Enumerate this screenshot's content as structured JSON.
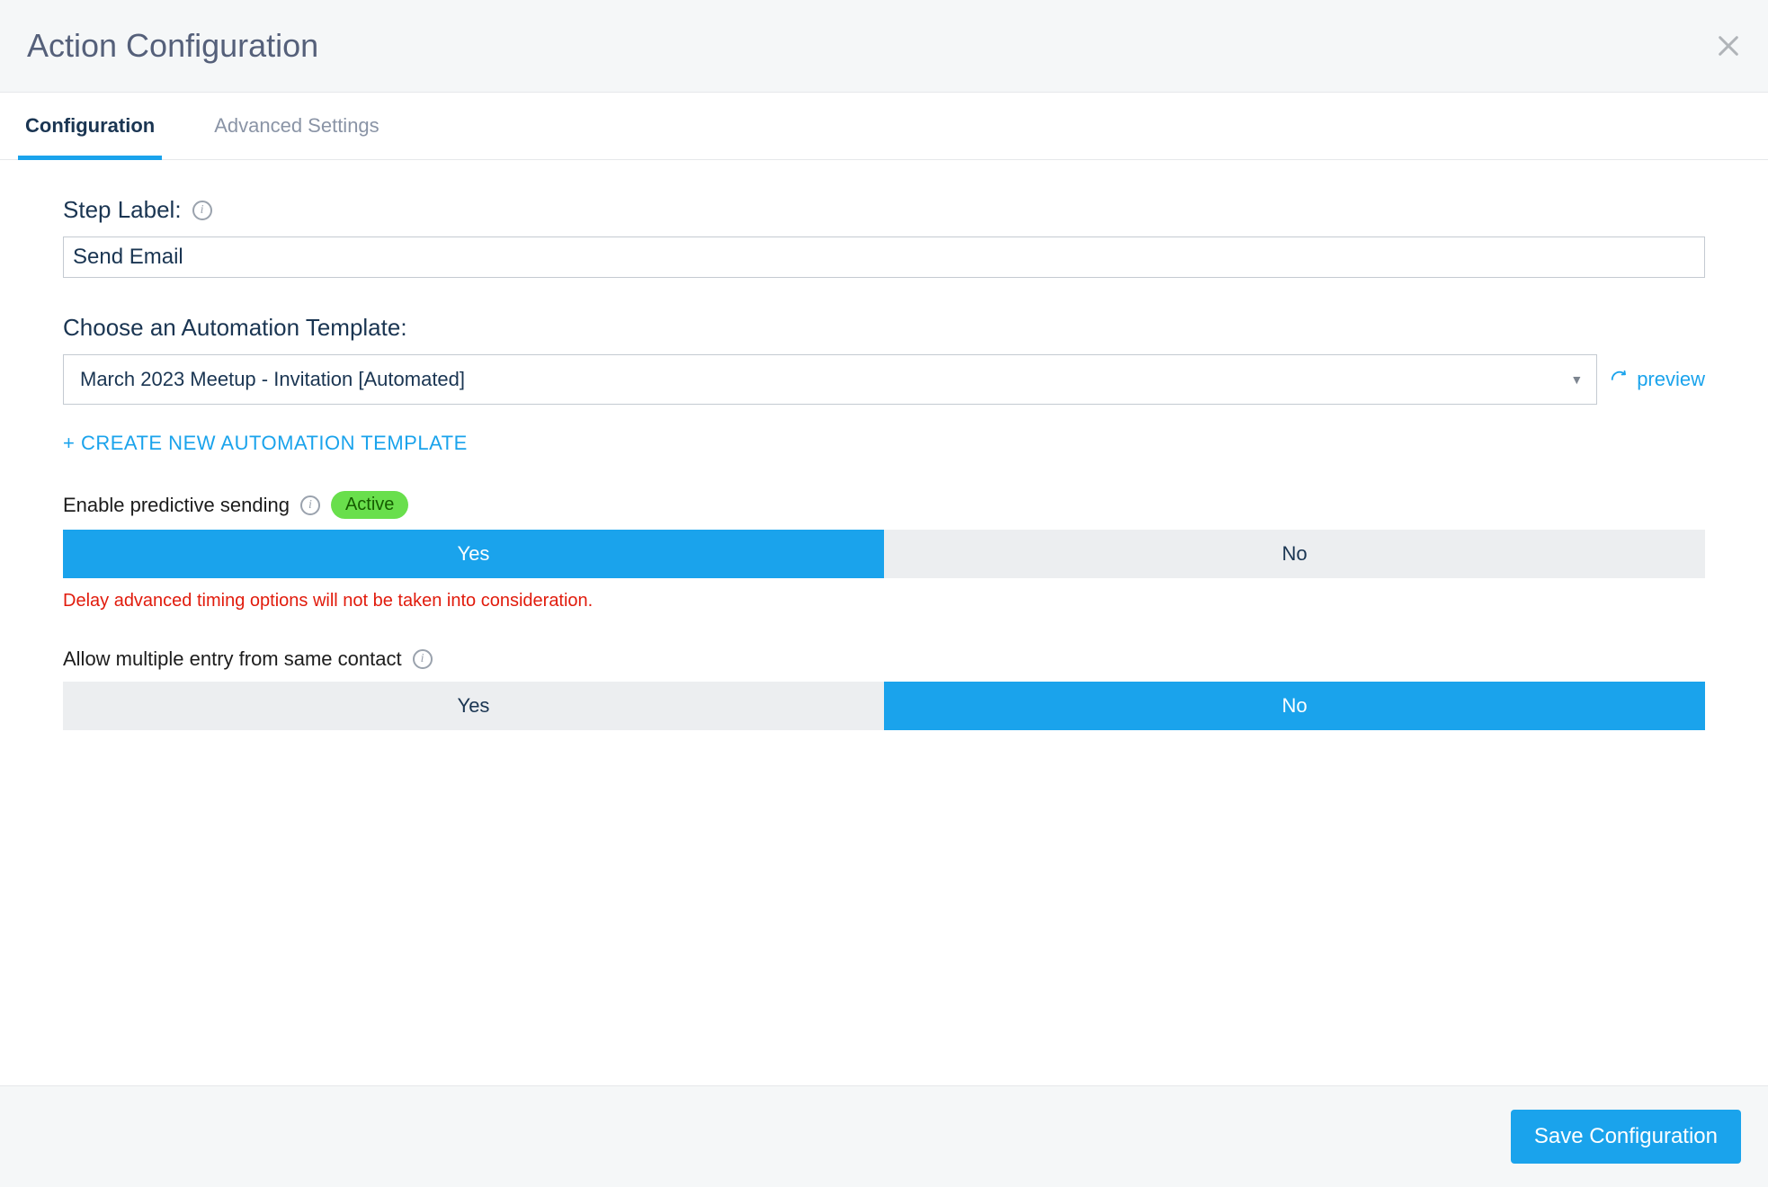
{
  "header": {
    "title": "Action Configuration"
  },
  "tabs": [
    {
      "label": "Configuration",
      "active": true
    },
    {
      "label": "Advanced Settings",
      "active": false
    }
  ],
  "step_label": {
    "label": "Step Label:",
    "value": "Send Email"
  },
  "template": {
    "label": "Choose an Automation Template:",
    "selected": "March 2023 Meetup - Invitation [Automated]",
    "preview_label": "preview",
    "create_link": "+ CREATE NEW AUTOMATION TEMPLATE"
  },
  "predictive": {
    "label": "Enable predictive sending",
    "badge": "Active",
    "yes": "Yes",
    "no": "No",
    "selected": "yes",
    "warning": "Delay advanced timing options will not be taken into consideration."
  },
  "multiple_entry": {
    "label": "Allow multiple entry from same contact",
    "yes": "Yes",
    "no": "No",
    "selected": "no"
  },
  "footer": {
    "save": "Save Configuration"
  }
}
